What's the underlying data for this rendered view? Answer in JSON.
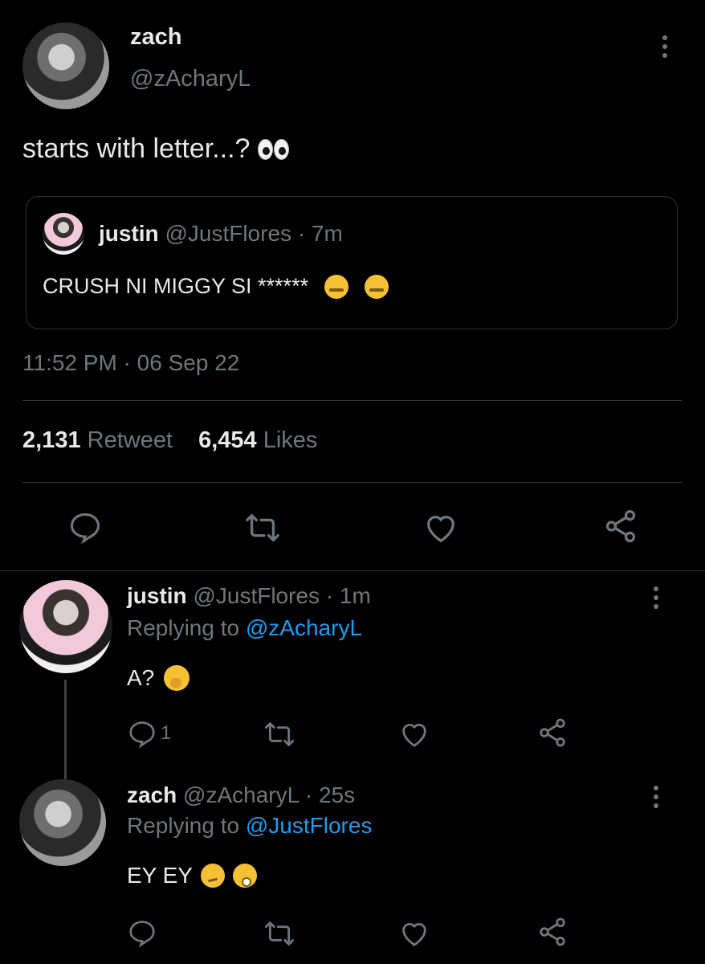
{
  "main_tweet": {
    "name": "zach",
    "handle": "@zAcharyL",
    "text": "starts with letter...?",
    "emoji": "eyes",
    "quoted": {
      "name": "justin",
      "handle_time": "@JustFlores · 7m",
      "text": "CRUSH NI MIGGY SI ******",
      "emoji": "zipper-mouth face x2"
    },
    "timestamp": "11:52 PM · 06 Sep 22",
    "stats": {
      "retweets_count": "2,131",
      "retweets_label": "Retweet",
      "likes_count": "6,454",
      "likes_label": "Likes"
    }
  },
  "replies": [
    {
      "name": "justin",
      "handle_time": "@JustFlores · 1m",
      "replying_prefix": "Replying to",
      "replying_to": "@zAcharyL",
      "text": "A?",
      "emoji": "face with hand over mouth",
      "reply_count": "1"
    },
    {
      "name": "zach",
      "handle_time": "@zAcharyL · 25s",
      "replying_prefix": "Replying to",
      "replying_to": "@JustFlores",
      "text": "EY EY",
      "emoji": "smirking face, flushed face"
    }
  ],
  "icons": {
    "reply": "reply-icon",
    "retweet": "retweet-icon",
    "like": "heart-icon",
    "share": "share-icon",
    "more": "more-vertical-icon"
  },
  "colors": {
    "background": "#000000",
    "text": "#e7e9ea",
    "muted": "#6e767d",
    "link": "#1d9bf0",
    "divider": "#2f3336"
  }
}
